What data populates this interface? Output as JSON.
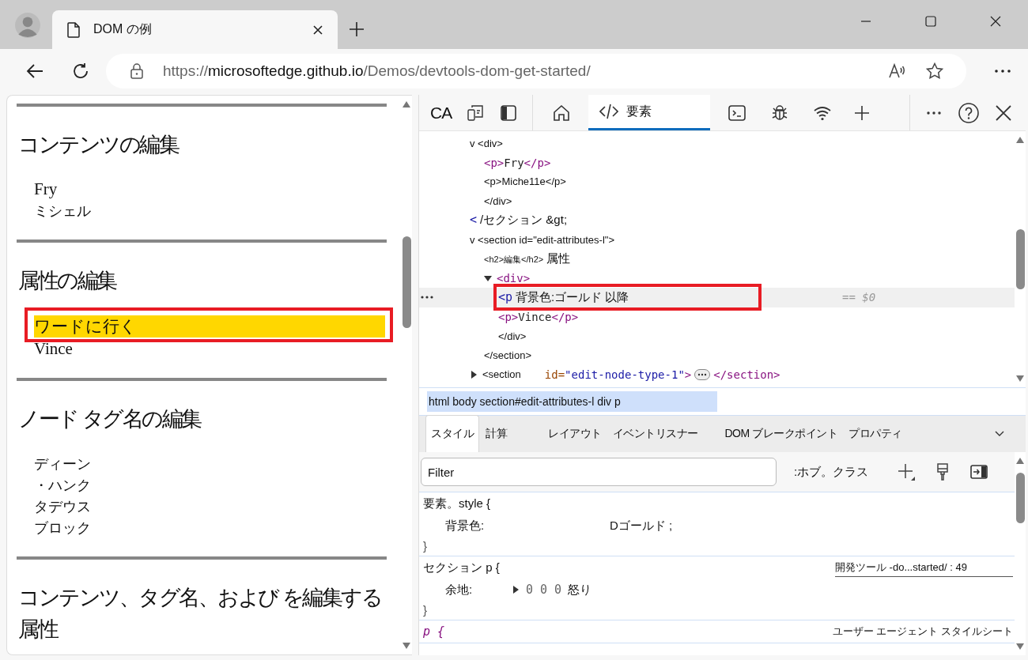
{
  "browser": {
    "tabs": [
      {
        "title": "DOM の例",
        "selected": true
      }
    ],
    "address_bar": {
      "scheme": "https://",
      "host": "microsoftedge.github.io",
      "path": "/Demos/devtools-dom-get-started/"
    }
  },
  "page": {
    "sections": [
      {
        "heading": "コンテンツの編集",
        "items": [
          {
            "text": "Fry",
            "kind": "latin",
            "highlighted": false
          },
          {
            "text": "ミシェル",
            "kind": "kana",
            "highlighted": false
          }
        ]
      },
      {
        "heading": "属性の編集",
        "items": [
          {
            "text": "ワードに行く",
            "kind": "kana",
            "highlighted": true
          },
          {
            "text": "Vince",
            "kind": "latin",
            "highlighted": false
          }
        ]
      },
      {
        "heading": "ノード タグ名の編集",
        "items": [
          {
            "text": "ディーン",
            "kind": "kana",
            "highlighted": false
          },
          {
            "text": "・ハンク",
            "kind": "kana",
            "highlighted": false
          },
          {
            "text": "タデウス",
            "kind": "kana",
            "highlighted": false
          },
          {
            "text": "ブロック",
            "kind": "kana",
            "highlighted": false
          }
        ]
      },
      {
        "heading": "コンテンツ、タグ名、および を編集する属性"
      }
    ]
  },
  "devtools": {
    "toolbar": {
      "inspect_label": "CA",
      "tabs": [
        {
          "kind": "home",
          "selected": false
        },
        {
          "kind": "elements",
          "label": "要素",
          "selected": true
        },
        {
          "kind": "console",
          "selected": false
        },
        {
          "kind": "sources",
          "selected": false
        },
        {
          "kind": "network",
          "selected": false
        }
      ]
    },
    "dom_tree": [
      {
        "kind": "plain",
        "text": "v <div>",
        "selected": false,
        "children": [
          {
            "kind": "code",
            "open": "<p>",
            "content": "Fry",
            "close": "</p>",
            "selected": false
          },
          {
            "kind": "plain",
            "text": "<p>Miche11e</p>",
            "selected": false
          },
          {
            "kind": "plain",
            "text": "</div>",
            "selected": false
          }
        ]
      },
      {
        "kind": "mixed",
        "mark": "<",
        "text": "/セクション &gt;",
        "selected": false
      },
      {
        "kind": "plain",
        "text": "v <section id=\"edit-attributes-l\">",
        "selected": false,
        "children": [
          {
            "kind": "pair",
            "small": "<h2>編集</h2>",
            "text": "属性",
            "selected": false
          },
          {
            "kind": "element",
            "tag": "<div>",
            "expanded": true,
            "selected": false,
            "children": [
              {
                "kind": "mixed",
                "mark": "<p",
                "text": "背景色:ゴールド 以降",
                "console_ref": "== $0",
                "selected": true
              },
              {
                "kind": "code",
                "open": "<p>",
                "content": "Vince",
                "close": "</p>",
                "selected": false
              },
              {
                "kind": "plain",
                "text": "</div>",
                "selected": false
              }
            ]
          },
          {
            "kind": "plain",
            "text": "</section>",
            "selected": false
          }
        ]
      },
      {
        "kind": "collapsed",
        "opener": "<section",
        "attr_name": "id=",
        "attr_value": "\"edit-node-type-1\"",
        "tag_end": ">",
        "close": "</section>",
        "expanded": false,
        "selected": false
      }
    ],
    "breadcrumb": "html body section#edit-attributes-l div p",
    "styles_tabs": [
      {
        "label": "スタイル",
        "selected": true
      },
      {
        "label": "計算",
        "selected": false
      },
      {
        "label": "レイアウト",
        "selected": false
      },
      {
        "label": "イベントリスナー",
        "selected": false
      },
      {
        "label": "DOM ブレークポイント",
        "selected": false
      },
      {
        "label": "プロパティ",
        "selected": false
      }
    ],
    "filter": {
      "placeholder": "Filter"
    },
    "hov_label": ":ホブ。クラス",
    "rules": [
      {
        "kind": "inline",
        "selector": "要素。style {",
        "properties": [
          {
            "name": "背景色:",
            "value": "Dゴールド ;"
          }
        ],
        "close": "}"
      },
      {
        "kind": "author",
        "selector": "セクション p {",
        "source": "開発ツール -do...started/ : 49",
        "properties": [
          {
            "name": "余地:",
            "value": "0 0 0",
            "suffix": "怒り",
            "expandable": true
          }
        ],
        "close": "}"
      },
      {
        "kind": "agent",
        "selector": "p {",
        "source": "ユーザー エージェント スタイルシート"
      }
    ]
  }
}
